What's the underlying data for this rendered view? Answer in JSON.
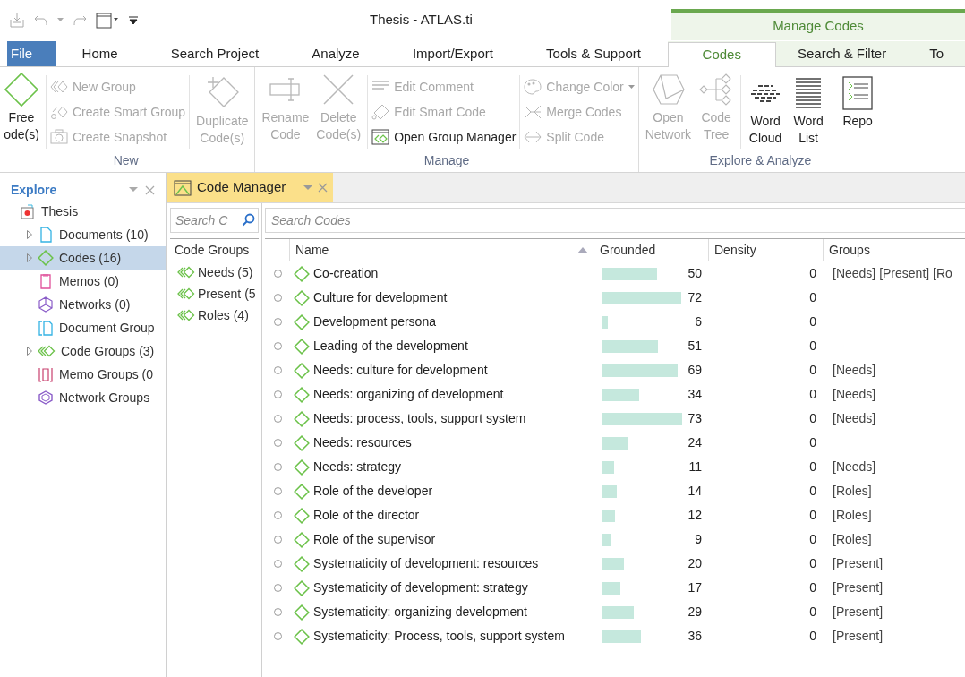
{
  "window": {
    "title": "Thesis - ATLAS.ti",
    "context_group": "Manage Codes"
  },
  "tabs": [
    {
      "label": "File",
      "kind": "file",
      "selected": false,
      "context": false
    },
    {
      "label": "Home",
      "kind": "tab",
      "selected": false,
      "context": false
    },
    {
      "label": "Search Project",
      "kind": "tab",
      "selected": false,
      "context": false
    },
    {
      "label": "Analyze",
      "kind": "tab",
      "selected": false,
      "context": false
    },
    {
      "label": "Import/Export",
      "kind": "tab",
      "selected": false,
      "context": false
    },
    {
      "label": "Tools & Support",
      "kind": "tab",
      "selected": false,
      "context": false
    },
    {
      "label": "Codes",
      "kind": "tab",
      "selected": true,
      "context": true
    },
    {
      "label": "Search & Filter",
      "kind": "tab",
      "selected": false,
      "context": true
    },
    {
      "label": "To",
      "kind": "tab",
      "selected": false,
      "context": true
    }
  ],
  "ribbon": [
    {
      "label": "New",
      "sets": [
        [
          {
            "kind": "large",
            "lines": [
              "Free",
              "ode(s)"
            ],
            "disabled": false
          }
        ],
        [
          {
            "kind": "small",
            "label": "New Group",
            "disabled": true
          },
          {
            "kind": "small",
            "label": "Create Smart Group",
            "disabled": true
          },
          {
            "kind": "small",
            "label": "Create Snapshot",
            "disabled": true
          }
        ],
        [
          {
            "kind": "large",
            "lines": [
              "Duplicate",
              "Code(s)"
            ],
            "disabled": true
          }
        ]
      ]
    },
    {
      "label": "Manage",
      "sets": [
        [
          {
            "kind": "large",
            "lines": [
              "Rename",
              "Code"
            ],
            "disabled": true
          },
          {
            "kind": "large",
            "lines": [
              "Delete",
              "Code(s)"
            ],
            "disabled": true
          }
        ],
        [
          {
            "kind": "small",
            "label": "Edit Comment",
            "disabled": true
          },
          {
            "kind": "small",
            "label": "Edit Smart Code",
            "disabled": true
          },
          {
            "kind": "small",
            "label": "Open Group Manager",
            "disabled": false
          }
        ],
        [
          {
            "kind": "small",
            "label": "Change Color",
            "disabled": true,
            "dropdown": true
          },
          {
            "kind": "small",
            "label": "Merge Codes",
            "disabled": true
          },
          {
            "kind": "small",
            "label": "Split Code",
            "disabled": true
          }
        ]
      ]
    },
    {
      "label": "Explore & Analyze",
      "sets": [
        [
          {
            "kind": "large",
            "lines": [
              "Open",
              "Network"
            ],
            "disabled": true
          },
          {
            "kind": "large",
            "lines": [
              "Code",
              "Tree"
            ],
            "disabled": true
          }
        ],
        [
          {
            "kind": "large",
            "lines": [
              "Word",
              "Cloud"
            ],
            "disabled": false
          },
          {
            "kind": "large",
            "lines": [
              "Word",
              "List"
            ],
            "disabled": false
          }
        ],
        [
          {
            "kind": "large",
            "lines": [
              "Repo"
            ],
            "disabled": false
          }
        ]
      ]
    }
  ],
  "explore": {
    "title": "Explore",
    "tree": [
      {
        "label": "Thesis",
        "kind": "project",
        "expandable": false,
        "selected": false,
        "children": [
          {
            "label": "Documents (10)",
            "kind": "document",
            "expandable": true,
            "selected": false
          },
          {
            "label": "Codes (16)",
            "kind": "code",
            "expandable": true,
            "selected": true
          },
          {
            "label": "Memos (0)",
            "kind": "memo",
            "expandable": false,
            "selected": false
          },
          {
            "label": "Networks (0)",
            "kind": "network",
            "expandable": false,
            "selected": false
          },
          {
            "label": "Document Group",
            "kind": "document-group",
            "expandable": false,
            "selected": false
          },
          {
            "label": "Code Groups (3)",
            "kind": "code-group",
            "expandable": true,
            "selected": false
          },
          {
            "label": "Memo Groups (0",
            "kind": "memo-group",
            "expandable": false,
            "selected": false
          },
          {
            "label": "Network Groups",
            "kind": "network-group",
            "expandable": false,
            "selected": false
          }
        ]
      }
    ]
  },
  "document_tab": {
    "title": "Code Manager"
  },
  "code_groups": {
    "search_placeholder": "Search C",
    "heading": "Code Groups",
    "items": [
      {
        "label": "Needs (5)"
      },
      {
        "label": "Present (5"
      },
      {
        "label": "Roles (4)"
      }
    ]
  },
  "codes": {
    "search_placeholder": "Search Codes",
    "columns": [
      {
        "label": "Name",
        "sorted": true
      },
      {
        "label": "Grounded",
        "sorted": false
      },
      {
        "label": "Density",
        "sorted": false
      },
      {
        "label": "Groups",
        "sorted": false
      }
    ],
    "rows": [
      {
        "name": "Co-creation",
        "checked": false,
        "grounded": "50",
        "density": "0",
        "groups": "[Needs] [Present] [Ro"
      },
      {
        "name": "Culture for development",
        "checked": false,
        "grounded": "72",
        "density": "0",
        "groups": ""
      },
      {
        "name": "Development persona",
        "checked": false,
        "grounded": "6",
        "density": "0",
        "groups": ""
      },
      {
        "name": "Leading of the development",
        "checked": false,
        "grounded": "51",
        "density": "0",
        "groups": ""
      },
      {
        "name": "Needs: culture for development",
        "checked": false,
        "grounded": "69",
        "density": "0",
        "groups": "[Needs]"
      },
      {
        "name": "Needs: organizing of development",
        "checked": false,
        "grounded": "34",
        "density": "0",
        "groups": "[Needs]"
      },
      {
        "name": "Needs: process, tools, support system",
        "checked": false,
        "grounded": "73",
        "density": "0",
        "groups": "[Needs]"
      },
      {
        "name": "Needs: resources",
        "checked": false,
        "grounded": "24",
        "density": "0",
        "groups": ""
      },
      {
        "name": "Needs: strategy",
        "checked": false,
        "grounded": "11",
        "density": "0",
        "groups": "[Needs]"
      },
      {
        "name": "Role of the developer",
        "checked": false,
        "grounded": "14",
        "density": "0",
        "groups": "[Roles]"
      },
      {
        "name": "Role of the director",
        "checked": false,
        "grounded": "12",
        "density": "0",
        "groups": "[Roles]"
      },
      {
        "name": "Role of the supervisor",
        "checked": false,
        "grounded": "9",
        "density": "0",
        "groups": "[Roles]"
      },
      {
        "name": "Systematicity of development: resources",
        "checked": false,
        "grounded": "20",
        "density": "0",
        "groups": "[Present]"
      },
      {
        "name": "Systematicity of development: strategy",
        "checked": false,
        "grounded": "17",
        "density": "0",
        "groups": "[Present]"
      },
      {
        "name": "Systematicity: organizing development",
        "checked": false,
        "grounded": "29",
        "density": "0",
        "groups": "[Present]"
      },
      {
        "name": "Systematicity: Process, tools, support system",
        "checked": false,
        "grounded": "36",
        "density": "0",
        "groups": "[Present]"
      }
    ]
  }
}
